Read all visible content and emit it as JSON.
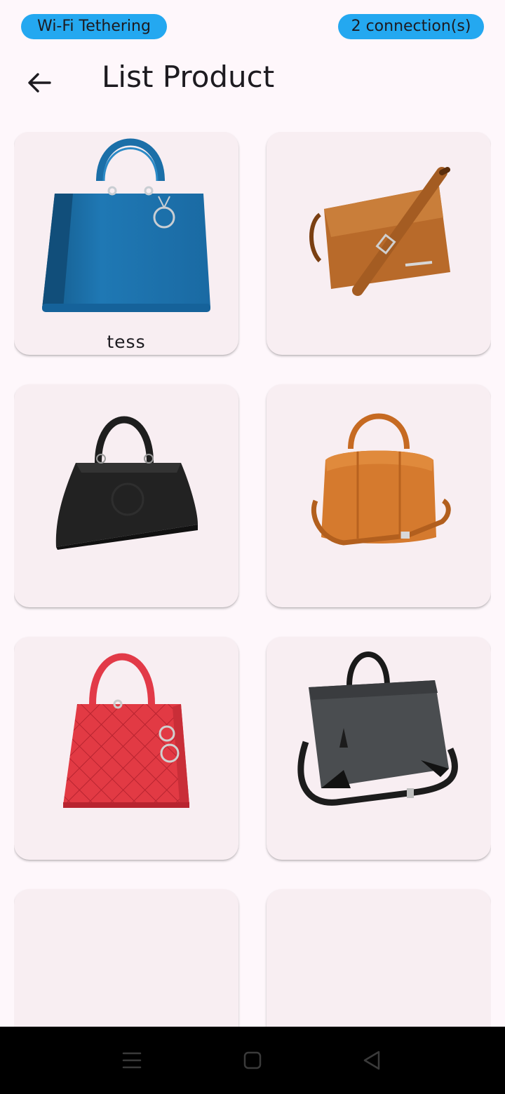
{
  "status_bar": {
    "left_pill": "Wi-Fi Tethering",
    "right_pill": "2 connection(s)",
    "pill_color": "#24A8F0"
  },
  "app_bar": {
    "back_icon": "arrow-back-icon",
    "title": "List Product"
  },
  "products": [
    {
      "label": "tess",
      "image": "blue-handbag"
    },
    {
      "label": "",
      "image": "brown-messenger-bag"
    },
    {
      "label": "",
      "image": "black-handbag"
    },
    {
      "label": "",
      "image": "tan-duffel-bag"
    },
    {
      "label": "",
      "image": "red-quilted-handbag"
    },
    {
      "label": "",
      "image": "grey-laptop-bag"
    },
    {
      "label": "",
      "image": ""
    },
    {
      "label": "",
      "image": ""
    }
  ],
  "nav_bar": {
    "menu_icon": "recent-apps-icon",
    "home_icon": "home-icon",
    "back_icon": "nav-back-icon"
  },
  "colors": {
    "background": "#FEF7FB",
    "card": "#F8EEF2",
    "nav_bar": "#000000"
  }
}
